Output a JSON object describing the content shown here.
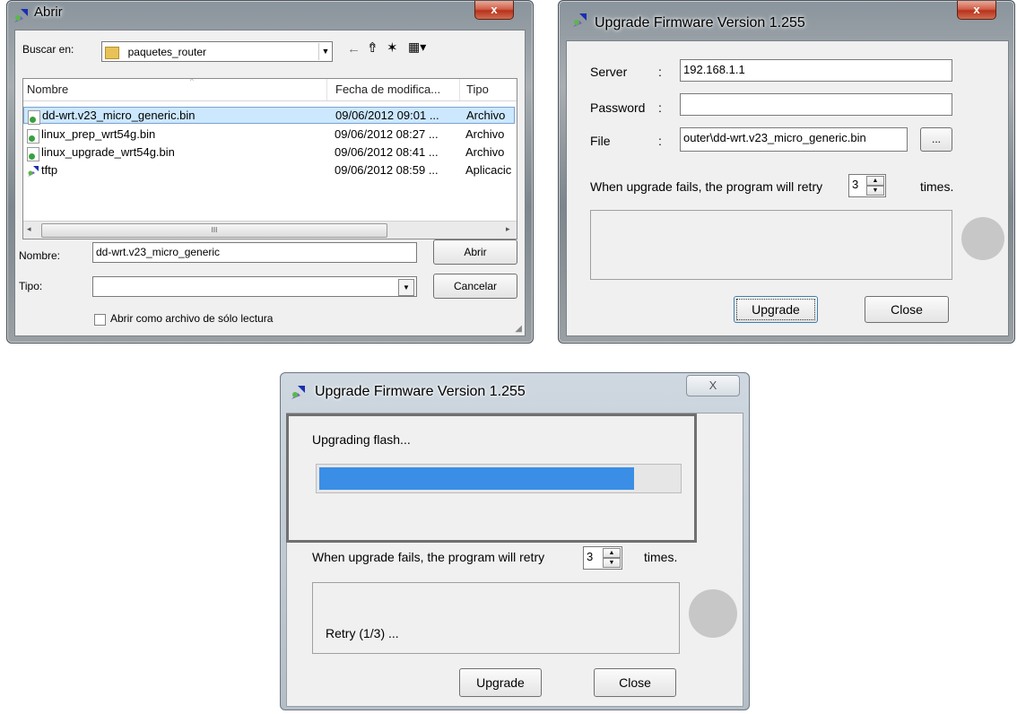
{
  "open_dialog": {
    "title": "Abrir",
    "close_glyph": "x",
    "look_in_label": "Buscar en:",
    "look_in_value": "paquetes_router",
    "toolbar_icons": [
      "back-arrow-icon",
      "up-folder-icon",
      "new-folder-icon",
      "view-menu-icon"
    ],
    "columns": [
      "Nombre",
      "Fecha de modifica...",
      "Tipo"
    ],
    "files": [
      {
        "name": "dd-wrt.v23_micro_generic.bin",
        "date": "09/06/2012 09:01 ...",
        "type": "Archivo",
        "selected": true
      },
      {
        "name": "linux_prep_wrt54g.bin",
        "date": "09/06/2012 08:27 ...",
        "type": "Archivo",
        "selected": false
      },
      {
        "name": "linux_upgrade_wrt54g.bin",
        "date": "09/06/2012 08:41 ...",
        "type": "Archivo",
        "selected": false
      },
      {
        "name": "tftp",
        "date": "09/06/2012 08:59 ...",
        "type": "Aplicacic",
        "selected": false
      }
    ],
    "scroll_grip": "III",
    "filename_label": "Nombre:",
    "filename_value": "dd-wrt.v23_micro_generic",
    "filetype_label": "Tipo:",
    "filetype_value": "",
    "open_button": "Abrir",
    "cancel_button": "Cancelar",
    "readonly_label": "Abrir como archivo de sólo lectura",
    "readonly_checked": false
  },
  "upgrade_dialog": {
    "title": "Upgrade Firmware Version 1.255",
    "close_glyph": "x",
    "server_label": "Server",
    "server_value": "192.168.1.1",
    "password_label": "Password",
    "password_value": "",
    "file_label": "File",
    "colon": ":",
    "file_value": "outer\\dd-wrt.v23_micro_generic.bin",
    "browse_button": "...",
    "retry_prefix": "When upgrade fails, the program will retry",
    "retry_value": "3",
    "retry_suffix": "times.",
    "upgrade_button": "Upgrade",
    "close_button": "Close"
  },
  "progress_dialog": {
    "title": "Upgrade Firmware Version 1.255",
    "close_glyph": "X",
    "status": "Upgrading flash...",
    "progress_fraction": 0.88,
    "progress_color": "#3a8ee6",
    "retry_prefix": "When upgrade fails, the program will retry",
    "retry_value": "3",
    "retry_suffix": "times.",
    "log_text": "Retry (1/3) ...",
    "upgrade_button": "Upgrade",
    "close_button": "Close"
  }
}
